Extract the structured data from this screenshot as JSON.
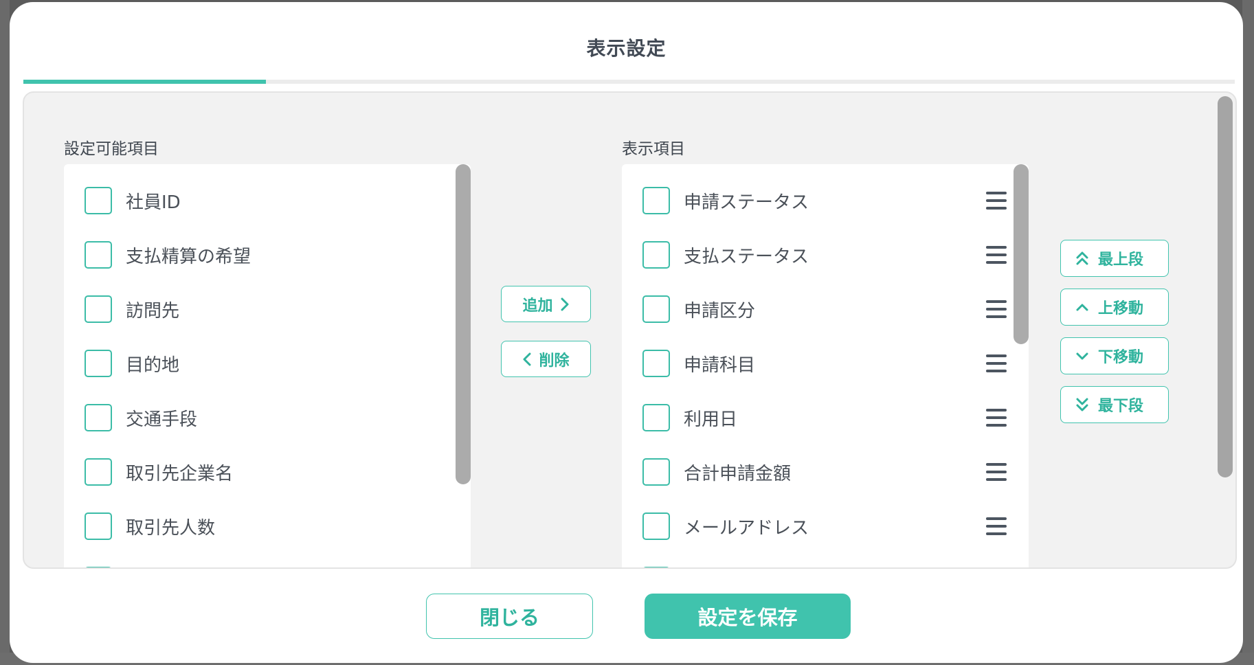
{
  "dialog": {
    "title": "表示設定",
    "progress_percent": 20
  },
  "available": {
    "label": "設定可能項目",
    "items": [
      "社員ID",
      "支払精算の希望",
      "訪問先",
      "目的地",
      "交通手段",
      "取引先企業名",
      "取引先人数"
    ]
  },
  "displayed": {
    "label": "表示項目",
    "items": [
      "申請ステータス",
      "支払ステータス",
      "申請区分",
      "申請科目",
      "利用日",
      "合計申請金額",
      "メールアドレス"
    ]
  },
  "transfer": {
    "add_label": "追加",
    "remove_label": "削除"
  },
  "order": {
    "top_label": "最上段",
    "up_label": "上移動",
    "down_label": "下移動",
    "bottom_label": "最下段"
  },
  "footer": {
    "close_label": "閉じる",
    "save_label": "設定を保存"
  },
  "colors": {
    "accent": "#40c3ad",
    "text": "#4a5058",
    "panel_bg": "#f2f2f2"
  }
}
